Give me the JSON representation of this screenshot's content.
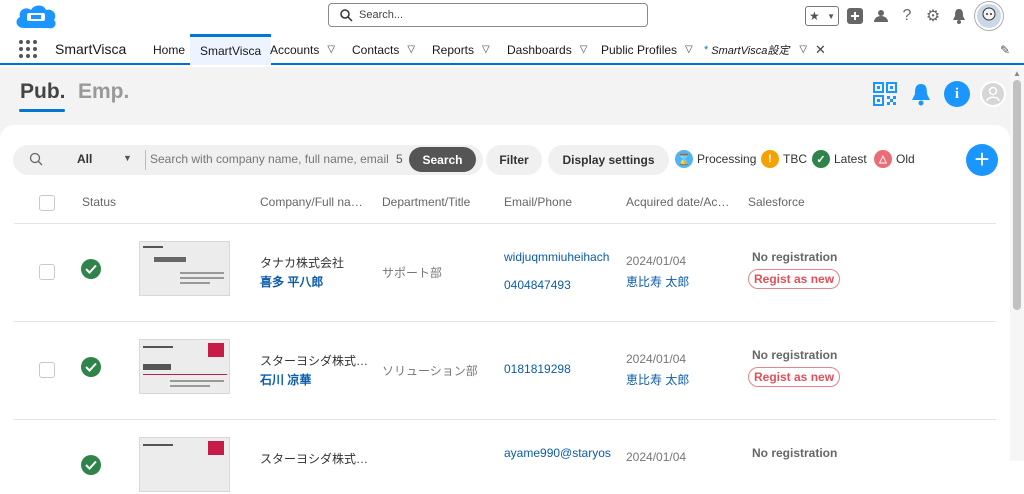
{
  "search": {
    "placeholder": "Search..."
  },
  "app_name": "SmartVisca",
  "nav": [
    {
      "label": "Home",
      "has_chevron": false
    },
    {
      "label": "SmartVisca",
      "active": true
    },
    {
      "label": "Accounts"
    },
    {
      "label": "Contacts"
    },
    {
      "label": "Reports"
    },
    {
      "label": "Dashboards"
    },
    {
      "label": "Public Profiles"
    }
  ],
  "open_tab": {
    "label": "SmartVisca設定",
    "marker": "*"
  },
  "tabs": {
    "pub": "Pub.",
    "emp": "Emp."
  },
  "filter": {
    "scope": "All",
    "search_placeholder": "Search with company name, full name, email",
    "count": "5",
    "search_button": "Search",
    "filter_button": "Filter",
    "display_button": "Display settings"
  },
  "legend": [
    {
      "label": "Processing",
      "color": "#4fb6f0",
      "icon": "hourglass-icon",
      "glyph": "⌛"
    },
    {
      "label": "TBC",
      "color": "#f5a100",
      "icon": "exclamation-icon",
      "glyph": "!"
    },
    {
      "label": "Latest",
      "color": "#2e844a",
      "icon": "check-icon",
      "glyph": "✓"
    },
    {
      "label": "Old",
      "color": "#ea6d76",
      "icon": "triangle-icon",
      "glyph": "△"
    }
  ],
  "columns": [
    "Status",
    "Company/Full na…",
    "Department/Title",
    "Email/Phone",
    "Acquired date/Ac…",
    "Salesforce"
  ],
  "rows": [
    {
      "company": "タナカ株式会社",
      "name": "喜多 平八郎",
      "dept": "サポート部",
      "email": "widjuqmmiuheihach",
      "phone": "0404847493",
      "date": "2024/01/04",
      "acquirer": "恵比寿 太郎",
      "sf_status": "No registration",
      "sf_action": "Regist as new"
    },
    {
      "company": "スターヨシダ株式…",
      "name": "石川 凉華",
      "dept": "ソリューション部",
      "email": "",
      "phone": "0181819298",
      "date": "2024/01/04",
      "acquirer": "恵比寿 太郎",
      "sf_status": "No registration",
      "sf_action": "Regist as new"
    },
    {
      "company": "スターヨシダ株式…",
      "name": "",
      "dept": "",
      "email": "ayame990@staryos",
      "phone": "",
      "date": "2024/01/04",
      "acquirer": "",
      "sf_status": "No registration",
      "sf_action": ""
    }
  ],
  "colors": {
    "brand_blue": "#0176d3",
    "ok_green": "#2e844a",
    "regist_red": "#e0505b"
  }
}
